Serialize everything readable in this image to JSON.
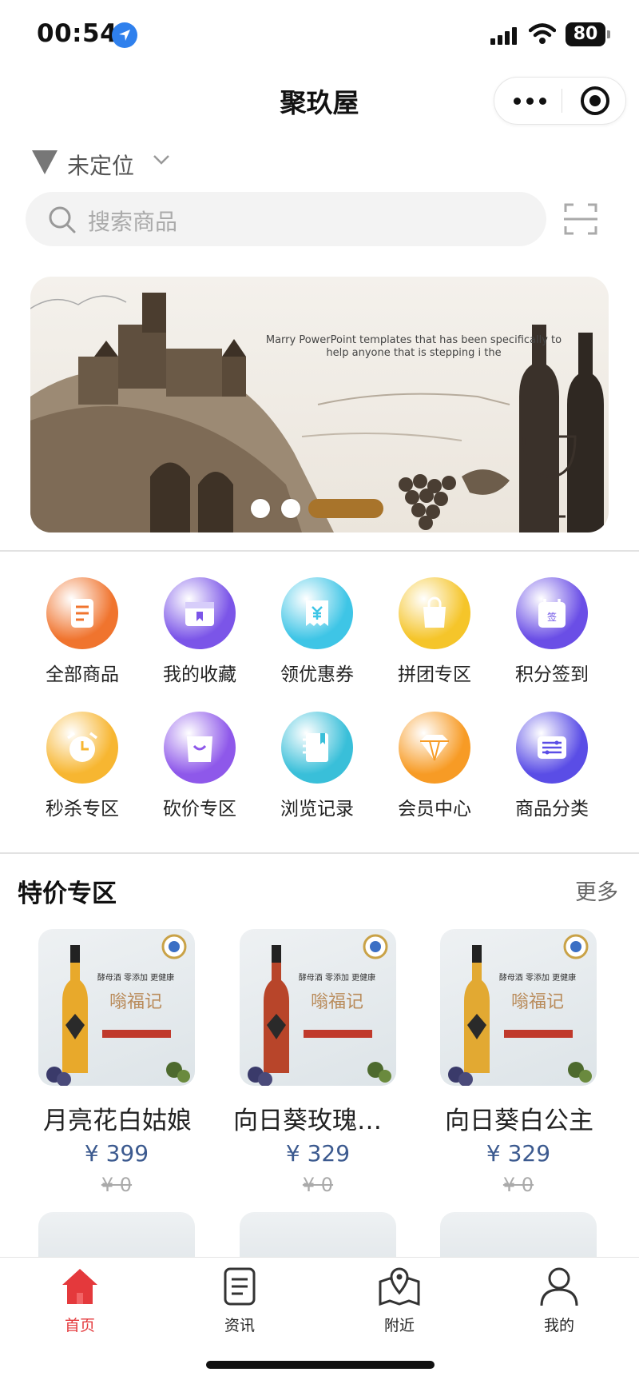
{
  "status_bar": {
    "time": "00:54",
    "battery": "80"
  },
  "nav": {
    "title": "聚玖屋"
  },
  "location": {
    "text": "未定位"
  },
  "search": {
    "placeholder": "搜索商品"
  },
  "banner": {
    "caption": "Marry PowerPoint templates that has been specifically to help anyone that is stepping i the",
    "slide_count": 3,
    "active_slide": 3
  },
  "grid": [
    {
      "label": "全部商品",
      "icon": "list-icon",
      "color": "#f0742e"
    },
    {
      "label": "我的收藏",
      "icon": "favorite-box-icon",
      "color": "#7b55e8"
    },
    {
      "label": "领优惠券",
      "icon": "coupon-icon",
      "color": "#3ec5e6"
    },
    {
      "label": "拼团专区",
      "icon": "shopping-bag-icon",
      "color": "#f5c52a"
    },
    {
      "label": "积分签到",
      "icon": "sign-in-calendar-icon",
      "color": "#6a4ee6"
    },
    {
      "label": "秒杀专区",
      "icon": "alarm-clock-icon",
      "color": "#f7b631"
    },
    {
      "label": "砍价专区",
      "icon": "bargain-bag-icon",
      "color": "#8e58ea"
    },
    {
      "label": "浏览记录",
      "icon": "notebook-icon",
      "color": "#39bfd9"
    },
    {
      "label": "会员中心",
      "icon": "diamond-icon",
      "color": "#f79b25"
    },
    {
      "label": "商品分类",
      "icon": "category-icon",
      "color": "#5a4de6"
    }
  ],
  "section": {
    "title": "特价专区",
    "more": "更多"
  },
  "products": [
    {
      "name": "月亮花白姑娘",
      "price": "¥ 399",
      "original_price": "¥ 0",
      "wine_color": "#e8a92b"
    },
    {
      "name": "向日葵玫瑰葡萄酒",
      "price": "¥ 329",
      "original_price": "¥ 0",
      "wine_color": "#b8452a"
    },
    {
      "name": "向日葵白公主",
      "price": "¥ 329",
      "original_price": "¥ 0",
      "wine_color": "#e2a932"
    }
  ],
  "product_image_text": {
    "slogan": "酵母酒 零添加 更健康",
    "brand": "嗡福记"
  },
  "tabs": [
    {
      "label": "首页",
      "icon": "home-icon",
      "active": true
    },
    {
      "label": "资讯",
      "icon": "news-icon",
      "active": false
    },
    {
      "label": "附近",
      "icon": "map-pin-icon",
      "active": false
    },
    {
      "label": "我的",
      "icon": "user-icon",
      "active": false
    }
  ],
  "colors": {
    "accent": "#e4393c",
    "price": "#3c5a8f",
    "banner_indicator": "#a8742b"
  }
}
